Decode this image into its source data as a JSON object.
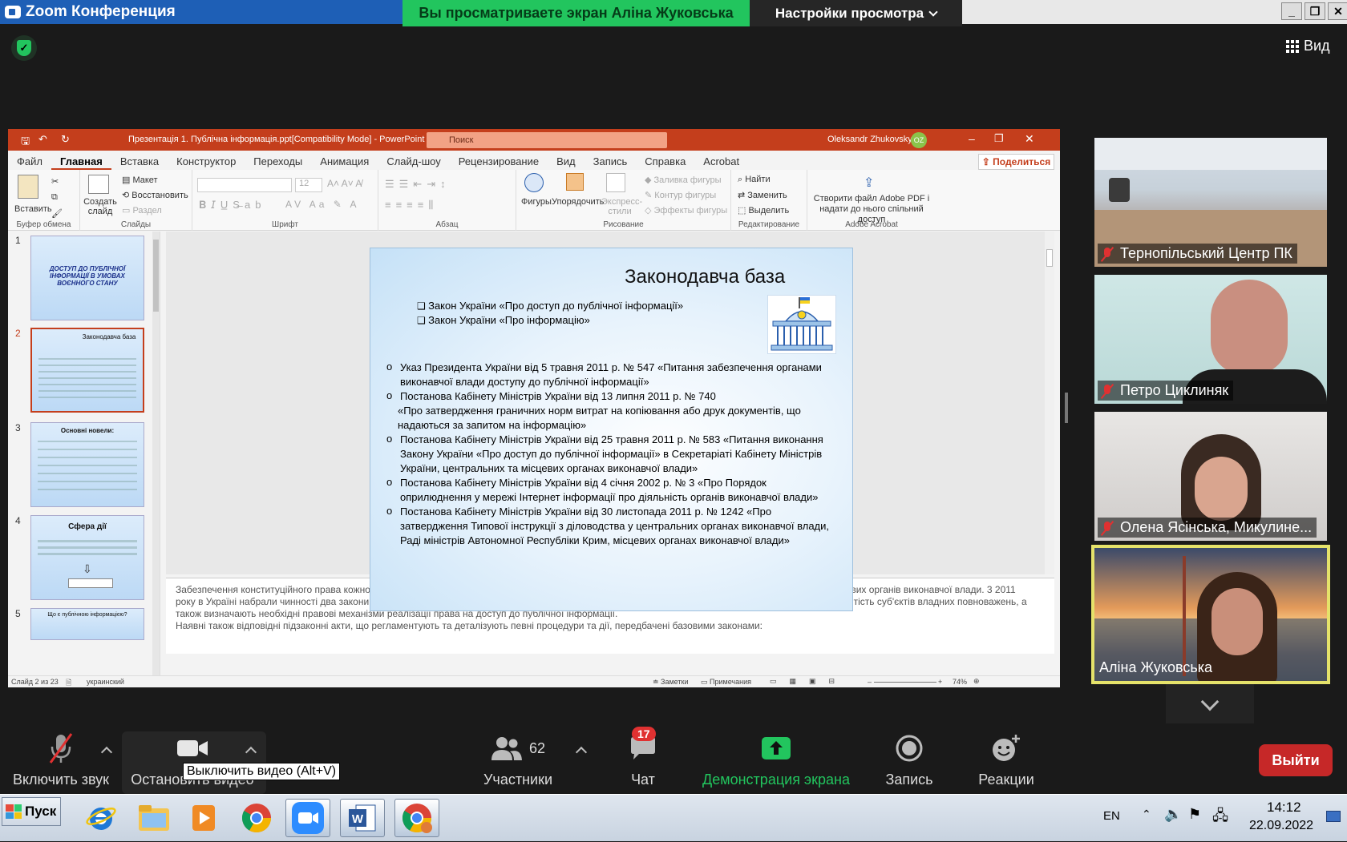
{
  "window": {
    "title": "Zoom Конференция",
    "banner": "Вы просматриваете экран Аліна Жуковська",
    "view_settings": "Настройки просмотра",
    "view_button": "Вид"
  },
  "ppt": {
    "title": "Презентація 1. Публічна інформація.ppt[Compatibility Mode]  -  PowerPoint",
    "search_placeholder": "Поиск",
    "user": "Oleksandr Zhukovsky",
    "user_initials": "OZ",
    "share": "Поделиться",
    "menu": [
      "Файл",
      "Главная",
      "Вставка",
      "Конструктор",
      "Переходы",
      "Анимация",
      "Слайд-шоу",
      "Рецензирование",
      "Вид",
      "Запись",
      "Справка",
      "Acrobat"
    ],
    "ribbon": {
      "clipboard": {
        "paste": "Вставить",
        "caption": "Буфер обмена"
      },
      "slides": {
        "new_slide": "Создать слайд",
        "layout": "Макет",
        "reset": "Восстановить",
        "section": "Раздел",
        "caption": "Слайды"
      },
      "font": {
        "size": "12",
        "caption": "Шрифт"
      },
      "paragraph": {
        "caption": "Абзац"
      },
      "drawing": {
        "shapes": "Фигуры",
        "arrange": "Упорядочить",
        "quick_styles": "Экспресс-стили",
        "fill": "Заливка фигуры",
        "outline": "Контур фигуры",
        "effects": "Эффекты фигуры",
        "caption": "Рисование"
      },
      "editing": {
        "find": "Найти",
        "replace": "Заменить",
        "select": "Выделить",
        "caption": "Редактирование"
      },
      "acrobat": {
        "create": "Створити файл Adobe PDF і надати до нього спільний доступ",
        "caption": "Adobe Acrobat"
      }
    },
    "thumbnails": [
      {
        "num": "1",
        "title": "ДОСТУП ДО ПУБЛІЧНОЇ ІНФОРМАЦІЇ В УМОВАХ ВОЄННОГО СТАНУ"
      },
      {
        "num": "2",
        "title": "Законодавча база"
      },
      {
        "num": "3",
        "title": "Основні новели:"
      },
      {
        "num": "4",
        "title": "Сфера дії"
      },
      {
        "num": "5",
        "title": "Що є публічною інформацією?"
      }
    ],
    "slide": {
      "title": "Законодавча база",
      "laws": [
        "Закон України «Про доступ до публічної інформації»",
        "Закон України «Про інформацію»"
      ],
      "items": [
        {
          "text": "Указ Президента України від 5 травня 2011 р. № 547 «Питання забезпечення органами виконавчої влади доступу до публічної інформації»"
        },
        {
          "text": "Постанова Кабінету Міністрів України від 13 липня 2011 р. № 740",
          "cont": "«Про затвердження граничних норм витрат на копіювання або друк документів, що надаються за запитом на інформацію»"
        },
        {
          "text": "Постанова Кабінету Міністрів України від 25 травня 2011 р. № 583 «Питання виконання Закону України «Про доступ до публічної інформації» в Секретаріаті Кабінету Міністрів України, центральних та місцевих органах виконавчої влади»"
        },
        {
          "text": "Постанова Кабінету Міністрів України від 4 січня 2002 р. № 3 «Про Порядок оприлюднення у мережі Інтернет інформації про діяльність органів виконавчої влади»"
        },
        {
          "text": "Постанова Кабінету Міністрів України від 30 листопада 2011 р. № 1242 «Про затвердження Типової інструкції з діловодства у центральних органах виконавчої влади, Раді міністрів Автономної Республіки Крим, місцевих органах виконавчої влади»"
        }
      ]
    },
    "notes": "Забезпечення конституційного права кожного на доступ до публічної інформації належить до найважливіших завдань діяльності центральних та місцевих органів виконавчої влади. 3 2011 року в Україні набрали чинності два закони «Про доступ до публічної інформації» та «Про інформацію», які покликані забезпечити прозорість та відкритість суб'єктів владних повноважень, а також визначають необхідні правові механізми реалізації права на доступ до публічної інформації.\nНаявні також відповідні підзаконні акти, що регламентують та деталізують певні процедури та дії, передбачені базовими законами:",
    "status": {
      "slide": "Слайд 2 из 23",
      "language": "украинский",
      "notes": "Заметки",
      "comments": "Примечания",
      "zoom": "74%"
    }
  },
  "participants": [
    {
      "name": "Тернопільський Центр ПК",
      "muted": true
    },
    {
      "name": "Петро Циклиняк",
      "muted": true
    },
    {
      "name": "Олена Ясінська, Микулине...",
      "muted": true
    },
    {
      "name": "Аліна Жуковська",
      "muted": false,
      "active": true
    }
  ],
  "toolbar": {
    "audio": "Включить звук",
    "video": "Остановить видео",
    "tooltip": "Выключить видео (Alt+V)",
    "participants": "Участники",
    "participants_count": "62",
    "chat": "Чат",
    "chat_badge": "17",
    "share": "Демонстрация экрана",
    "record": "Запись",
    "reactions": "Реакции",
    "leave": "Выйти"
  },
  "taskbar": {
    "start": "Пуск",
    "lang": "EN",
    "time": "14:12",
    "date": "22.09.2022"
  }
}
